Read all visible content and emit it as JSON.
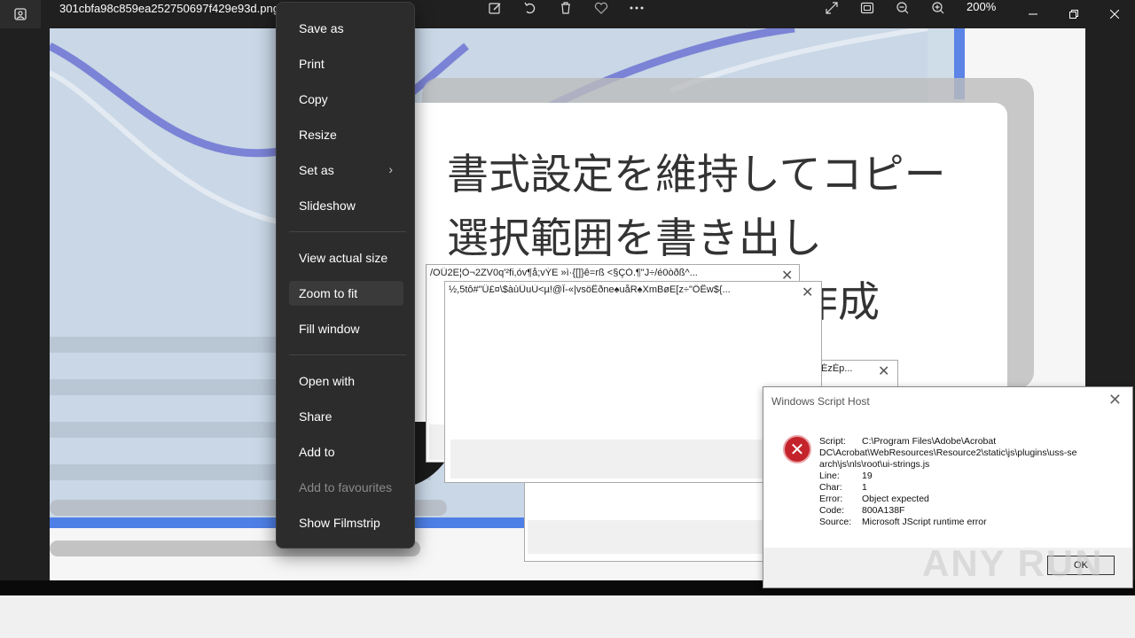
{
  "window": {
    "filename": "301cbfa98c859ea252750697f429e93d.png",
    "zoom": "200%"
  },
  "toolbar": {
    "icons": [
      "edit-image-icon",
      "rotate-icon",
      "delete-icon",
      "favourite-icon",
      "more-icon",
      "fullscreen-icon",
      "actual-size-icon",
      "zoom-out-icon",
      "zoom-in-icon"
    ]
  },
  "image": {
    "line1": "書式設定を維持してコピー",
    "line2": "選択範囲を書き出し",
    "line3": "作成"
  },
  "menu": {
    "items": [
      {
        "label": "Save as"
      },
      {
        "label": "Print"
      },
      {
        "label": "Copy"
      },
      {
        "label": "Resize"
      },
      {
        "label": "Set as"
      },
      {
        "label": "Slideshow"
      },
      {
        "label": "View actual size"
      },
      {
        "label": "Zoom to fit"
      },
      {
        "label": "Fill window"
      },
      {
        "label": "Open with"
      },
      {
        "label": "Share"
      },
      {
        "label": "Add to"
      },
      {
        "label": "Add to favourites"
      },
      {
        "label": "Show Filmstrip"
      }
    ]
  },
  "garbled": {
    "title1": "/OÜ2E¦Ò¬2ZV0q'²fi,óv¶å;vÝE »ì·{[]}ê=rß <§ÇÒ.¶\"J÷/é0òðß^...",
    "title2": "½,5tô#\"Ü£¤\\$àùÛuÙ<µ!@Î-«|vsöÊðne♠uåR♠XmBøE[z÷\"ÖÊw${...",
    "title3": "ÉzÉp..."
  },
  "wsh": {
    "title": "Windows Script Host",
    "script_key": "Script:",
    "script_val1": "C:\\Program Files\\Adobe\\Acrobat",
    "script_val2": "DC\\Acrobat\\WebResources\\Resource2\\static\\js\\plugins\\uss-se",
    "script_val3": "arch\\js\\nls\\root\\ui-strings.js",
    "line_key": "Line:",
    "line_val": "19",
    "char_key": "Char:",
    "char_val": "1",
    "error_key": "Error:",
    "error_val": "Object expected",
    "code_key": "Code:",
    "code_val": "800A138F",
    "source_key": "Source:",
    "source_val": "Microsoft JScript runtime error",
    "ok_label": "OK"
  },
  "watermark": "ANY RUN"
}
